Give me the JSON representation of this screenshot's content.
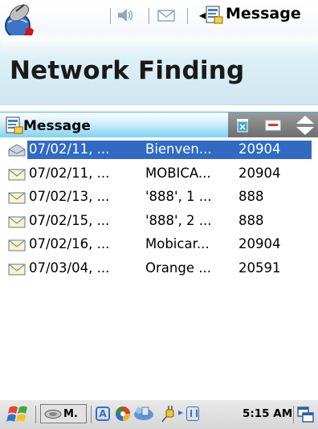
{
  "statusbar": {
    "title": "Message"
  },
  "header": {
    "title": "Network Finding"
  },
  "list": {
    "title": "Message",
    "selected_index": 0,
    "rows": [
      {
        "date": "07/02/11, ...",
        "subject": "Bienven...",
        "sender": "20904",
        "read": true
      },
      {
        "date": "07/02/11, ...",
        "subject": "MOBICA...",
        "sender": "20904",
        "read": false
      },
      {
        "date": "07/02/13, ...",
        "subject": "'888', 1 ...",
        "sender": "888",
        "read": false
      },
      {
        "date": "07/02/15, ...",
        "subject": "'888', 2 ...",
        "sender": "888",
        "read": false
      },
      {
        "date": "07/02/16, ...",
        "subject": "Mobicar...",
        "sender": "20904",
        "read": false
      },
      {
        "date": "07/03/04, ...",
        "subject": "Orange ...",
        "sender": "20591",
        "read": false
      }
    ]
  },
  "taskbar": {
    "task_label": "M.",
    "ime_label": "A",
    "clock": "5:15 AM"
  },
  "colors": {
    "selection": "#316ac5",
    "list_header": "#7ed3f3",
    "header_band": "#cfe8f1"
  },
  "icons": [
    "app-network-icon",
    "volume-icon",
    "mail-notify-icon",
    "message-icon",
    "delete-icon",
    "compose-icon",
    "sort-arrows-icon",
    "envelope-icon",
    "start-flag-icon",
    "keyboard-toggle-icon"
  ]
}
